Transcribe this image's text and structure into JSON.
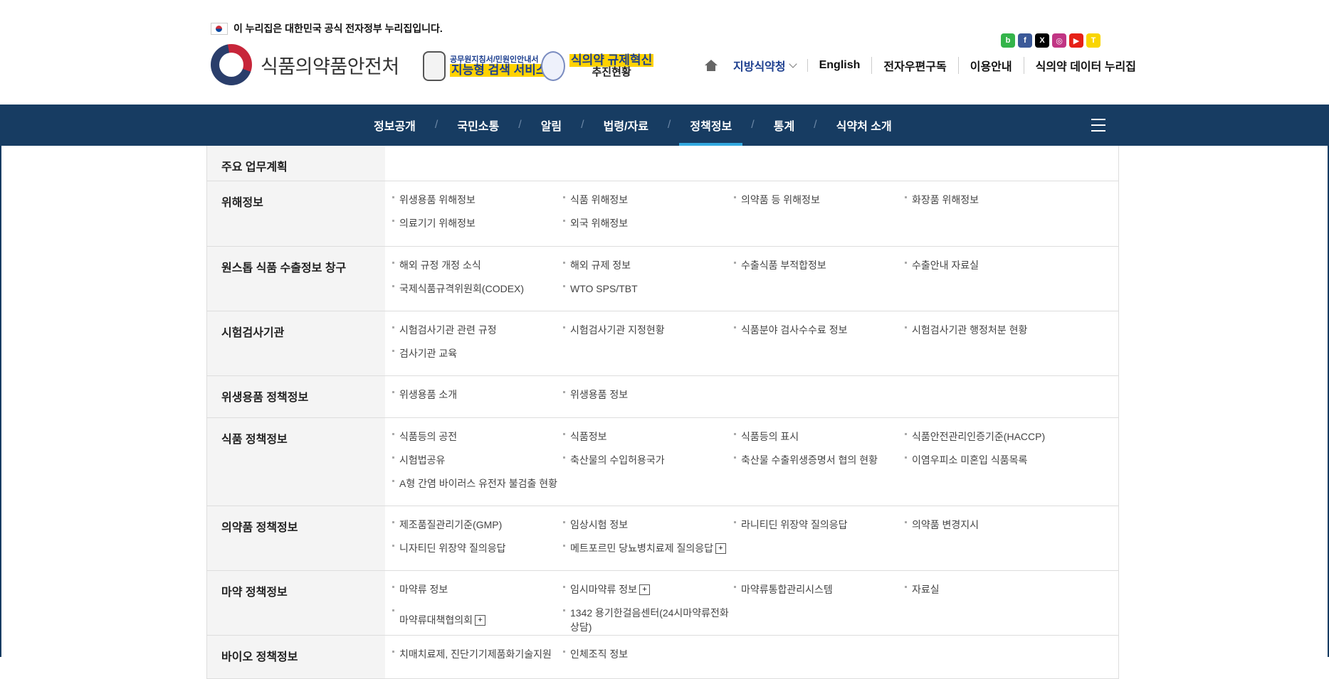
{
  "gov_banner": "이 누리집은 대한민국 공식 전자정부 누리집입니다.",
  "logo_text": "식품의약품안전처",
  "banner_ai": {
    "small": "공무원지침서/민원인안내서",
    "big": "지능형 검색 서비스"
  },
  "banner_reform": {
    "line1": "식의약 규제혁신",
    "line2": "추진현황"
  },
  "social": [
    {
      "name": "blog-icon",
      "glyph": "b",
      "color": "#34b44a"
    },
    {
      "name": "facebook-icon",
      "glyph": "f",
      "color": "#3b5998"
    },
    {
      "name": "x-icon",
      "glyph": "X",
      "color": "#000000"
    },
    {
      "name": "instagram-icon",
      "glyph": "◎",
      "color": "#c13584"
    },
    {
      "name": "youtube-icon",
      "glyph": "▶",
      "color": "#e62117"
    },
    {
      "name": "kakaotalk-icon",
      "glyph": "T",
      "color": "#f9d500"
    }
  ],
  "utils": [
    "지방식약청",
    "English",
    "전자우편구독",
    "이용안내",
    "식의약 데이터 누리집"
  ],
  "gnb": [
    "정보공개",
    "국민소통",
    "알림",
    "법령/자료",
    "정책정보",
    "통계",
    "식약처 소개"
  ],
  "gnb_active": "정책정보",
  "menu": [
    {
      "title": "주요 업무계획",
      "links": []
    },
    {
      "title": "위해정보",
      "links": [
        {
          "text": "위생용품 위해정보"
        },
        {
          "text": "식품 위해정보"
        },
        {
          "text": "의약품 등 위해정보"
        },
        {
          "text": "화장품 위해정보"
        },
        {
          "text": "의료기기 위해정보"
        },
        {
          "text": "외국 위해정보"
        }
      ]
    },
    {
      "title": "원스톱 식품 수출정보 창구",
      "links": [
        {
          "text": "해외 규정 개정 소식"
        },
        {
          "text": "해외 규제 정보"
        },
        {
          "text": "수출식품 부적합정보"
        },
        {
          "text": "수출안내 자료실"
        },
        {
          "text": "국제식품규격위원회(CODEX)"
        },
        {
          "text": "WTO SPS/TBT"
        }
      ]
    },
    {
      "title": "시험검사기관",
      "links": [
        {
          "text": "시험검사기관 관련 규정"
        },
        {
          "text": "시험검사기관 지정현황"
        },
        {
          "text": "식품분야 검사수수료 정보"
        },
        {
          "text": "시험검사기관 행정처분 현황"
        },
        {
          "text": "검사기관 교육"
        }
      ]
    },
    {
      "title": "위생용품 정책정보",
      "links": [
        {
          "text": "위생용품 소개"
        },
        {
          "text": "위생용품 정보"
        }
      ]
    },
    {
      "title": "식품 정책정보",
      "links": [
        {
          "text": "식품등의 공전"
        },
        {
          "text": "식품정보"
        },
        {
          "text": "식품등의 표시"
        },
        {
          "text": "식품안전관리인증기준(HACCP)"
        },
        {
          "text": "시험법공유"
        },
        {
          "text": "축산물의 수입허용국가"
        },
        {
          "text": "축산물 수출위생증명서 협의 현황"
        },
        {
          "text": "이염우피소 미혼입 식품목록"
        },
        {
          "text": "A형 간염 바이러스 유전자 불검출 현황"
        }
      ]
    },
    {
      "title": "의약품 정책정보",
      "links": [
        {
          "text": "제조품질관리기준(GMP)"
        },
        {
          "text": "임상시험 정보"
        },
        {
          "text": "라니티딘 위장약 질의응답"
        },
        {
          "text": "의약품 변경지시"
        },
        {
          "text": "니자티딘 위장약 질의응답"
        },
        {
          "text": "메트포르민 당뇨병치료제 질의응답",
          "plus": "+"
        }
      ]
    },
    {
      "title": "마약 정책정보",
      "links": [
        {
          "text": "마약류 정보"
        },
        {
          "text": "임시마약류 정보",
          "plus": "+"
        },
        {
          "text": "마약류통합관리시스템"
        },
        {
          "text": "자료실"
        },
        {
          "text": "마약류대책협의회",
          "plus": "+"
        },
        {
          "text": "1342 용기한걸음센터(24시마약류전화상담)"
        }
      ]
    },
    {
      "title": "바이오 정책정보",
      "links": [
        {
          "text": "치매치료제, 진단기기제품화기술지원"
        },
        {
          "text": "인체조직 정보"
        }
      ]
    }
  ]
}
